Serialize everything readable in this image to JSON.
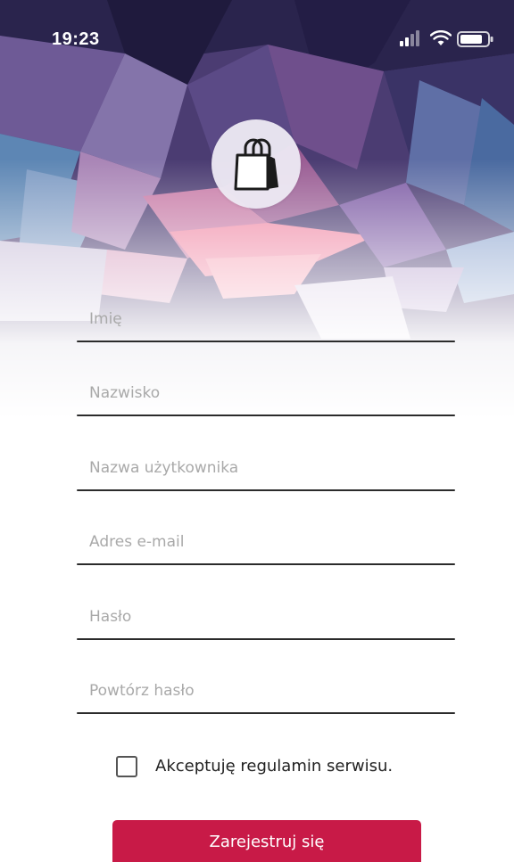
{
  "status_bar": {
    "time": "19:23",
    "icons": [
      "signal-icon",
      "wifi-icon",
      "battery-icon"
    ]
  },
  "logo": {
    "icon": "shopping-bag-icon"
  },
  "form": {
    "fields": [
      {
        "placeholder": "Imię",
        "value": ""
      },
      {
        "placeholder": "Nazwisko",
        "value": ""
      },
      {
        "placeholder": "Nazwa użytkownika",
        "value": ""
      },
      {
        "placeholder": "Adres e-mail",
        "value": ""
      },
      {
        "placeholder": "Hasło",
        "value": ""
      },
      {
        "placeholder": "Powtórz hasło",
        "value": ""
      }
    ],
    "terms_label": "Akceptuję regulamin serwisu.",
    "terms_checked": false,
    "submit_label": "Zarejestruj się"
  },
  "colors": {
    "accent": "#c81a47",
    "underline": "#2b2b2b",
    "placeholder": "#a9a9a9"
  }
}
